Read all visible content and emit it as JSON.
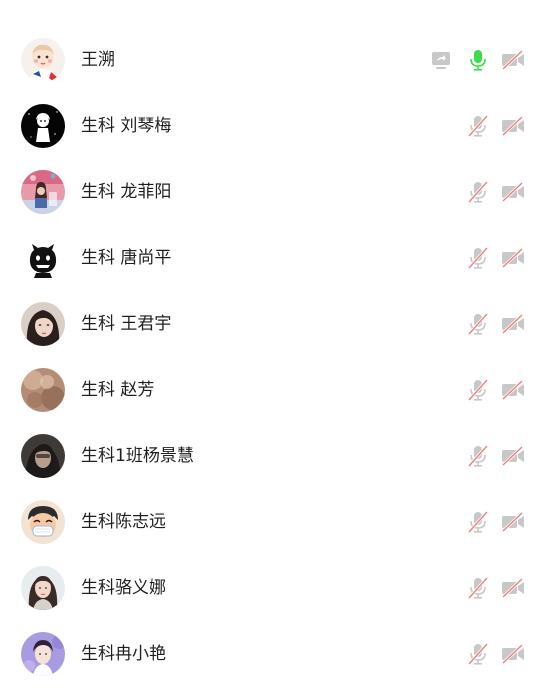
{
  "participants": [
    {
      "name": "王溯",
      "avatar": "cartoon-baby-avatar",
      "mic": "on",
      "camera": "off",
      "screen_share_icon": true
    },
    {
      "name": "生科 刘琴梅",
      "avatar": "cartoon-girl-dark-avatar",
      "mic": "off",
      "camera": "off"
    },
    {
      "name": "生科 龙菲阳",
      "avatar": "photo-pink-avatar",
      "mic": "off",
      "camera": "off"
    },
    {
      "name": "生科 唐尚平",
      "avatar": "black-creature-avatar",
      "mic": "off",
      "camera": "off"
    },
    {
      "name": "生科 王君宇",
      "avatar": "photo-woman-avatar",
      "mic": "off",
      "camera": "off"
    },
    {
      "name": "生科 赵芳",
      "avatar": "photo-blurred-avatar",
      "mic": "off",
      "camera": "off"
    },
    {
      "name": "生科1班杨景慧",
      "avatar": "photo-dark-avatar",
      "mic": "off",
      "camera": "off"
    },
    {
      "name": "生科陈志远",
      "avatar": "cartoon-mask-avatar",
      "mic": "off",
      "camera": "off"
    },
    {
      "name": "生科骆义娜",
      "avatar": "photo-girl-avatar",
      "mic": "off",
      "camera": "off"
    },
    {
      "name": "生科冉小艳",
      "avatar": "photo-purple-avatar",
      "mic": "off",
      "camera": "off"
    }
  ],
  "colors": {
    "mic_on": "#3ddc4a",
    "icon_gray": "#c8c8c8",
    "mute_slash": "#f08080",
    "name_text": "#1f1f1f"
  }
}
